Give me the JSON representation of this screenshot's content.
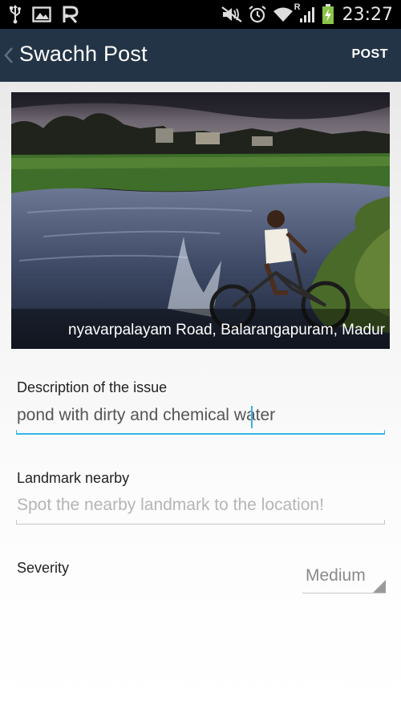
{
  "status_bar": {
    "time": "23:27",
    "icons": [
      "usb-icon",
      "image-icon",
      "r-app-icon",
      "mute-icon",
      "alarm-icon",
      "wifi-icon",
      "signal-icon",
      "battery-charging-icon"
    ],
    "roaming_label": "R"
  },
  "action_bar": {
    "title": "Swachh Post",
    "post_label": "POST",
    "background": "#243447"
  },
  "photo": {
    "location_caption": "nyavarpalayam Road, Balarangapuram, Madur"
  },
  "form": {
    "description": {
      "label": "Description of the issue",
      "value": "pond with dirty and chemical water",
      "focused": true
    },
    "landmark": {
      "label": "Landmark nearby",
      "placeholder": "Spot the nearby landmark to the location!",
      "value": ""
    },
    "severity": {
      "label": "Severity",
      "selected": "Medium"
    }
  },
  "colors": {
    "accent": "#33b5e5",
    "inactive_line": "#c7c7c7"
  }
}
